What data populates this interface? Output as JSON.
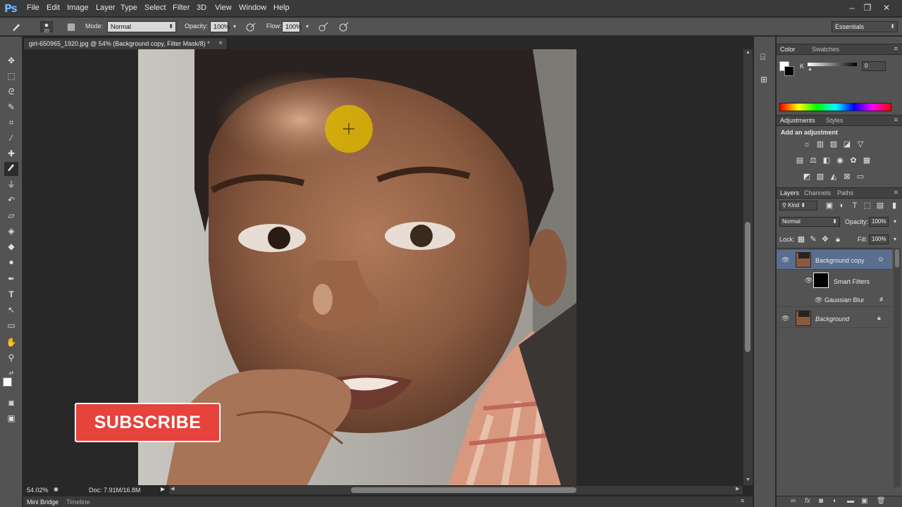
{
  "app": {
    "logo": "Ps"
  },
  "menu": [
    "File",
    "Edit",
    "Image",
    "Layer",
    "Type",
    "Select",
    "Filter",
    "3D",
    "View",
    "Window",
    "Help"
  ],
  "window_controls": {
    "minimize": "–",
    "restore": "❐",
    "close": "✕"
  },
  "options": {
    "brush_size": "20",
    "mode_label": "Mode:",
    "mode_value": "Normal",
    "opacity_label": "Opacity:",
    "opacity_value": "100%",
    "flow_label": "Flow:",
    "flow_value": "100%",
    "workspace": "Essentials"
  },
  "document": {
    "tab_title": "girl-650965_1920.jpg @ 54% (Background copy, Filter Mask/8) *",
    "close": "×"
  },
  "status": {
    "zoom": "54.02%",
    "doc_size": "Doc: 7.91M/16.8M"
  },
  "bottom_tabs": [
    "Mini Bridge",
    "Timeline"
  ],
  "overlay": {
    "subscribe": "SUBSCRIBE"
  },
  "color_panel": {
    "tabs": [
      "Color",
      "Swatches"
    ],
    "channel_label": "K",
    "channel_value": "0"
  },
  "adjustments_panel": {
    "tabs": [
      "Adjustments",
      "Styles"
    ],
    "heading": "Add an adjustment"
  },
  "layers_panel": {
    "tabs": [
      "Layers",
      "Channels",
      "Paths"
    ],
    "kind": "Kind",
    "blend_mode": "Normal",
    "opacity_label": "Opacity:",
    "opacity_value": "100%",
    "lock_label": "Lock:",
    "fill_label": "Fill:",
    "fill_value": "100%",
    "layers": [
      {
        "name": "Background copy"
      },
      {
        "name": "Smart Filters"
      },
      {
        "name": "Gaussian Blur"
      },
      {
        "name": "Background"
      }
    ]
  },
  "colors": {
    "accent_subscribe": "#e6433d",
    "selected_layer": "#5a6f8f",
    "brush_cursor": "#d9b400"
  }
}
